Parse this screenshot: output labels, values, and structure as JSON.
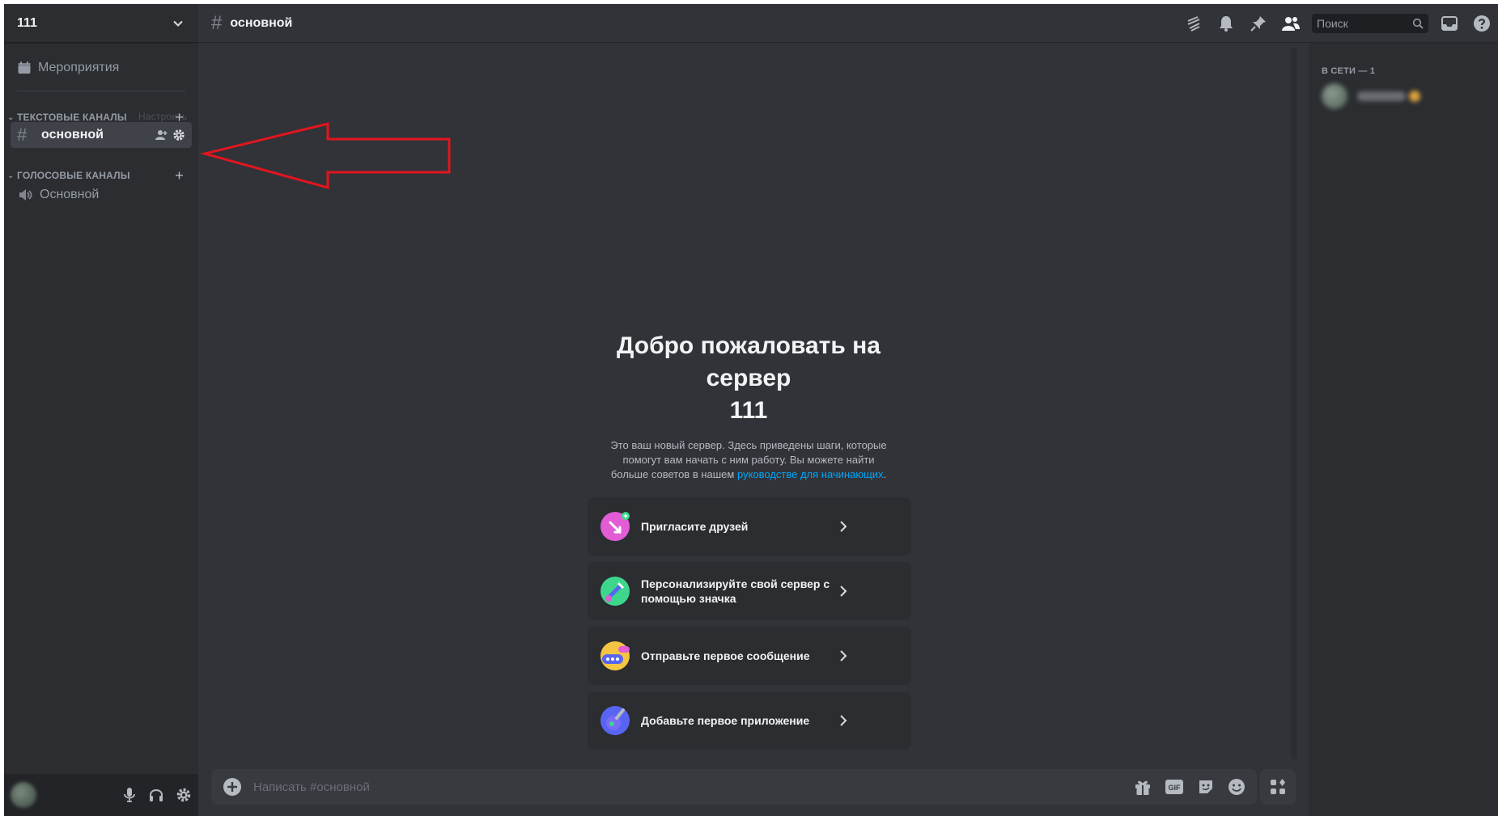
{
  "server": {
    "name": "111"
  },
  "sidebar": {
    "events_label": "Мероприятия",
    "categories": [
      {
        "label": "ТЕКСТОВЫЕ КАНАЛЫ",
        "tooltip": "Настроить канал"
      },
      {
        "label": "ГОЛОСОВЫЕ КАНАЛЫ"
      }
    ],
    "text_channels": [
      {
        "name": "основной"
      }
    ],
    "voice_channels": [
      {
        "name": "Основной"
      }
    ]
  },
  "header": {
    "channel_name": "основной",
    "search_placeholder": "Поиск",
    "icons": [
      "threads-icon",
      "bell-icon",
      "pin-icon",
      "members-icon",
      "inbox-icon",
      "help-icon"
    ]
  },
  "welcome": {
    "title": "Добро пожаловать на сервер",
    "server": "111",
    "text_before_link": "Это ваш новый сервер. Здесь приведены шаги, которые помогут вам начать с ним работу. Вы можете найти больше советов в нашем ",
    "link": "руководстве для начинающих",
    "text_after_link": "."
  },
  "cards": [
    {
      "label": "Пригласите друзей",
      "icon": "invite-icon",
      "color": "#e25dd5"
    },
    {
      "label": "Персонализируйте свой сервер с помощью значка",
      "icon": "brush-icon",
      "color": "#3dd68c"
    },
    {
      "label": "Отправьте первое сообщение",
      "icon": "message-icon",
      "color": "#f4c542"
    },
    {
      "label": "Добавьте первое приложение",
      "icon": "app-icon",
      "color": "#5865f2"
    }
  ],
  "composer": {
    "placeholder": "Написать #основной"
  },
  "members": {
    "group_label": "В СЕТИ — 1"
  },
  "colors": {
    "accent_link": "#00a8fc",
    "annotation_arrow": "#e3151f"
  }
}
